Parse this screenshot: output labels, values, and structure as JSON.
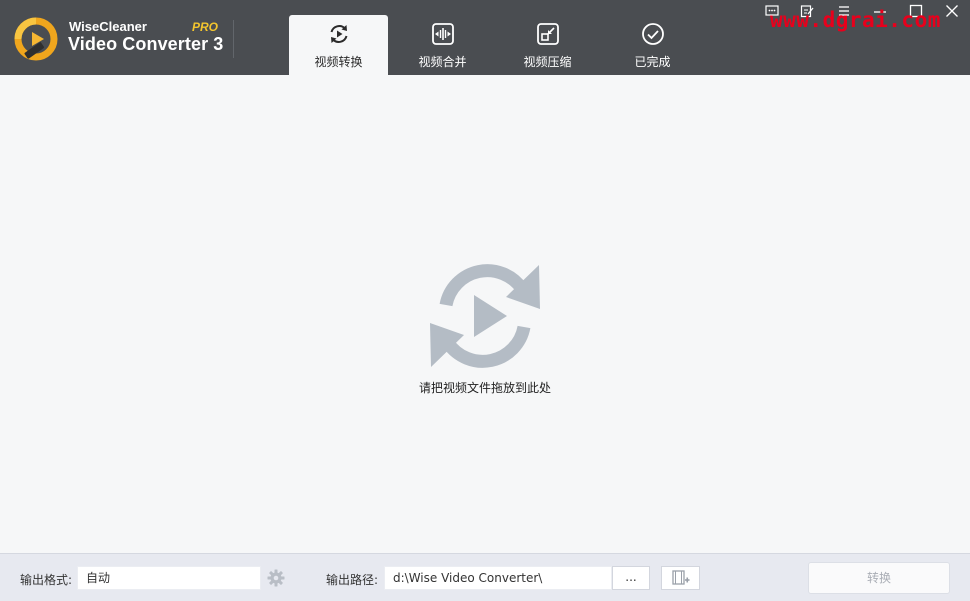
{
  "app": {
    "brand_top": "WiseCleaner",
    "brand_main": "Video Converter 3",
    "brand_pro": "PRO"
  },
  "tabs": [
    {
      "label": "视频转换",
      "icon": "convert-icon",
      "active": true
    },
    {
      "label": "视频合并",
      "icon": "merge-icon",
      "active": false
    },
    {
      "label": "视频压缩",
      "icon": "compress-icon",
      "active": false
    },
    {
      "label": "已完成",
      "icon": "done-icon",
      "active": false
    }
  ],
  "window_controls": [
    "message-icon",
    "feedback-icon",
    "menu-icon",
    "minimize-icon",
    "maximize-icon",
    "close-icon"
  ],
  "watermark": "www.dgrai.com",
  "content": {
    "drop_text": "请把视频文件拖放到此处"
  },
  "footer": {
    "format_label": "输出格式:",
    "format_value": "自动",
    "path_label": "输出路径:",
    "path_value": "d:\\Wise Video Converter\\",
    "browse_label": "...",
    "convert_label": "转换"
  },
  "colors": {
    "header_bg": "#4a4d51",
    "content_bg": "#f6f7f8",
    "footer_bg": "#e7e9f0",
    "icon_gray": "#b4bcc5",
    "pro_yellow": "#f3c52e",
    "watermark_red": "#e8001c"
  }
}
